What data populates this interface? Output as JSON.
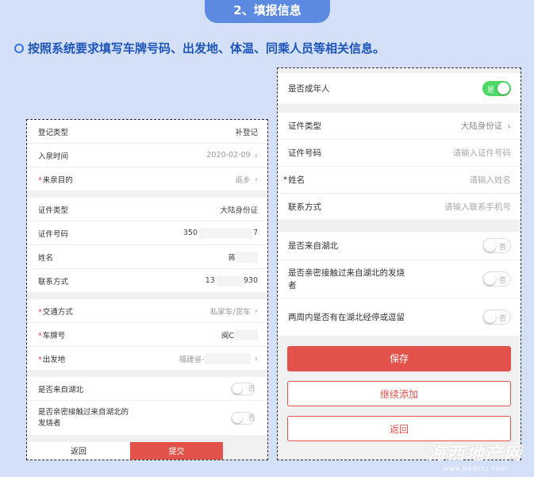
{
  "step_banner": "2、填报信息",
  "instruction": "按照系统要求填写车牌号码、出发地、体温、同乘人员等相关信息。",
  "left_form": {
    "section1": [
      {
        "label": "登记类型",
        "value": "补登记",
        "muted": false,
        "chevron": false,
        "required": false
      },
      {
        "label": "入泉时间",
        "value": "2020-02-09",
        "muted": true,
        "chevron": true,
        "required": false
      },
      {
        "label": "来泉目的",
        "value": "返乡",
        "muted": true,
        "chevron": true,
        "required": true
      }
    ],
    "section2": [
      {
        "label": "证件类型",
        "value": "大陆身份证"
      },
      {
        "label": "证件号码",
        "value_prefix": "350",
        "value_suffix": "7"
      },
      {
        "label": "姓名",
        "value_prefix": "蒋",
        "value_suffix": ""
      },
      {
        "label": "联系方式",
        "value_prefix": "13",
        "value_suffix": "930"
      }
    ],
    "section3": [
      {
        "label": "交通方式",
        "value": "私家车/货车",
        "required": true
      },
      {
        "label": "车牌号",
        "value": "闽C",
        "required": true
      },
      {
        "label": "出发地",
        "value": "福建省-",
        "required": true
      }
    ],
    "section4": [
      {
        "label": "是否来自湖北",
        "toggle": "否"
      },
      {
        "label": "是否亲密接触过来自湖北的发烧者",
        "toggle": "否"
      }
    ],
    "footer": {
      "back": "返回",
      "submit": "提交"
    }
  },
  "right_form": {
    "adult": {
      "label": "是否成年人",
      "toggle": "是"
    },
    "identity": [
      {
        "label": "证件类型",
        "value": "大陆身份证",
        "chevron": true,
        "required": false
      },
      {
        "label": "证件号码",
        "placeholder": "请输入证件号码",
        "required": false
      },
      {
        "label": "姓名",
        "placeholder": "请输入姓名",
        "required": true
      },
      {
        "label": "联系方式",
        "placeholder": "请输入联系手机号",
        "required": false
      }
    ],
    "questions": [
      {
        "label": "是否来自湖北",
        "toggle": "否"
      },
      {
        "label": "是否亲密接触过来自湖北的发烧者",
        "toggle": "否"
      },
      {
        "label": "两周内是否有在湖北经停或逗留",
        "toggle": "否"
      }
    ],
    "buttons": {
      "save": "保存",
      "continue": "继续添加",
      "back": "返回"
    }
  },
  "watermark": {
    "title": "海西地产网",
    "url": "www.hxdctz.com"
  },
  "colors": {
    "accent_blue": "#5b8ae0",
    "primary_red": "#e2524a",
    "toggle_on": "#4cd964",
    "background": "#d4e0f7"
  }
}
